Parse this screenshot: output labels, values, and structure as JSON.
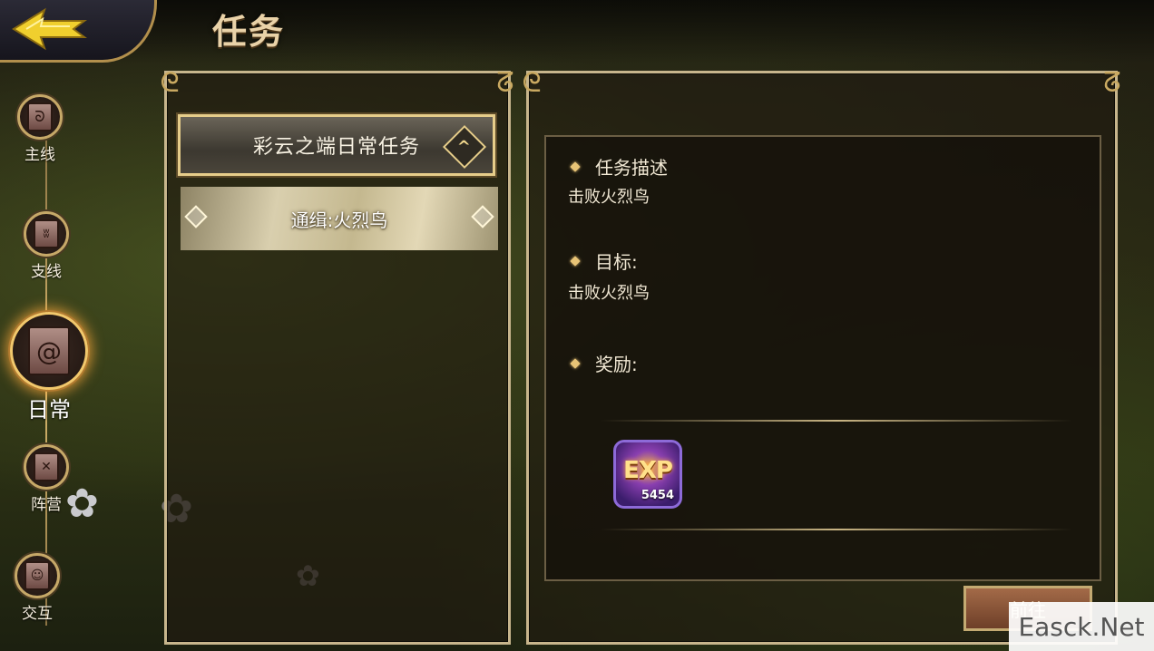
{
  "header": {
    "title": "任务"
  },
  "side_nav": {
    "items": [
      {
        "label": "主线",
        "active": false
      },
      {
        "label": "支线",
        "active": false
      },
      {
        "label": "日常",
        "active": true
      },
      {
        "label": "阵营",
        "active": false
      },
      {
        "label": "交互",
        "active": false
      }
    ]
  },
  "quest_list": {
    "category": "彩云之端日常任务",
    "quests": [
      {
        "label": "通缉:火烈鸟",
        "selected": true
      }
    ]
  },
  "quest_detail": {
    "description_title": "任务描述",
    "description_text": "击败火烈鸟",
    "objective_title": "目标:",
    "objective_text": "击败火烈鸟",
    "reward_title": "奖励:",
    "rewards": [
      {
        "icon": "exp-icon",
        "label": "EXP",
        "amount": "5454"
      }
    ]
  },
  "go_button": {
    "label": "前往"
  },
  "watermark": {
    "text": "Easck.Net"
  },
  "colors": {
    "frame_gold": "#c7b58c",
    "accent_gold": "#e6cd8a",
    "active_glow": "#ffaa3c",
    "exp_purple": "#8d6ad8"
  }
}
